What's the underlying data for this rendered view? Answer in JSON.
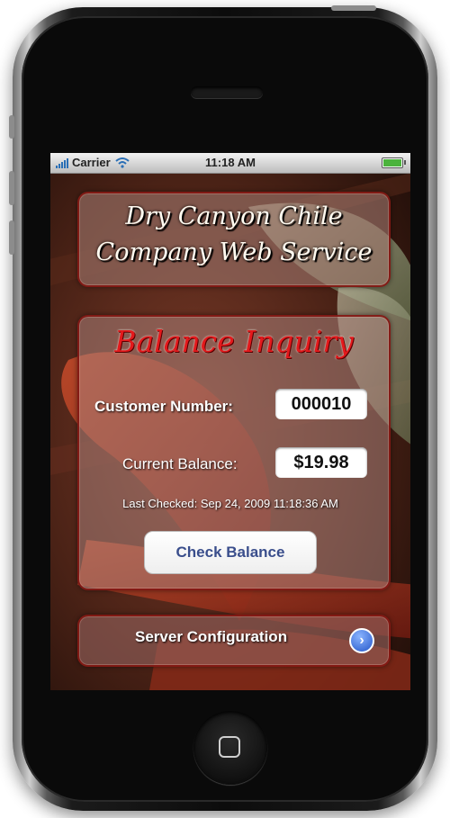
{
  "status_bar": {
    "carrier": "Carrier",
    "time": "11:18 AM",
    "signal_icon": "signal-bars-icon",
    "wifi_icon": "wifi-icon",
    "battery_icon": "battery-icon"
  },
  "header": {
    "title_line1": "Dry Canyon Chile",
    "title_line2": "Company Web Service"
  },
  "inquiry": {
    "title": "Balance Inquiry",
    "customer_number_label": "Customer Number:",
    "customer_number_value": "000010",
    "current_balance_label": "Current Balance:",
    "current_balance_value": "$19.98",
    "last_checked": "Last Checked: Sep 24, 2009 11:18:36 AM",
    "check_button": "Check Balance"
  },
  "footer": {
    "server_config_label": "Server Configuration",
    "disclosure_icon": "chevron-right-icon"
  },
  "colors": {
    "title_red": "#e3191c",
    "button_text": "#3a4e8c",
    "disclosure_blue": "#2456c8",
    "battery_green": "#4bb33c"
  }
}
